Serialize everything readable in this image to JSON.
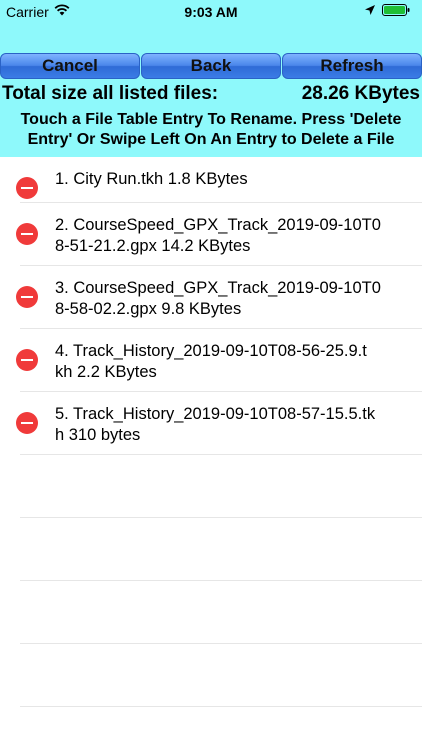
{
  "status_bar": {
    "carrier": "Carrier",
    "time": "9:03 AM",
    "icons": [
      "wifi-icon",
      "location-arrow-icon",
      "battery-icon"
    ]
  },
  "toolbar": {
    "cancel_label": "Cancel",
    "back_label": "Back",
    "refresh_label": "Refresh"
  },
  "summary": {
    "total_label": "Total size all listed files:",
    "total_value": "28.26 KBytes"
  },
  "instructions": "Touch a File Table Entry To Rename. Press 'Delete Entry' Or Swipe Left On An Entry to Delete a File",
  "files": [
    {
      "line1": "1.  City Run.tkh            1.8 KBytes",
      "line2": ""
    },
    {
      "line1": "2.   CourseSpeed_GPX_Track_2019-09-10T0",
      "line2": "8-51-21.2.gpx        14.2 KBytes"
    },
    {
      "line1": "3.   CourseSpeed_GPX_Track_2019-09-10T0",
      "line2": "8-58-02.2.gpx          9.8 KBytes"
    },
    {
      "line1": "4.   Track_History_2019-09-10T08-56-25.9.t",
      "line2": "kh        2.2 KBytes"
    },
    {
      "line1": "5.  Track_History_2019-09-10T08-57-15.5.tk",
      "line2": "h           310 bytes"
    }
  ],
  "colors": {
    "header_bg": "#8ef9fb",
    "button_blue": "#3b7ce6",
    "delete_red": "#f03a3a"
  }
}
